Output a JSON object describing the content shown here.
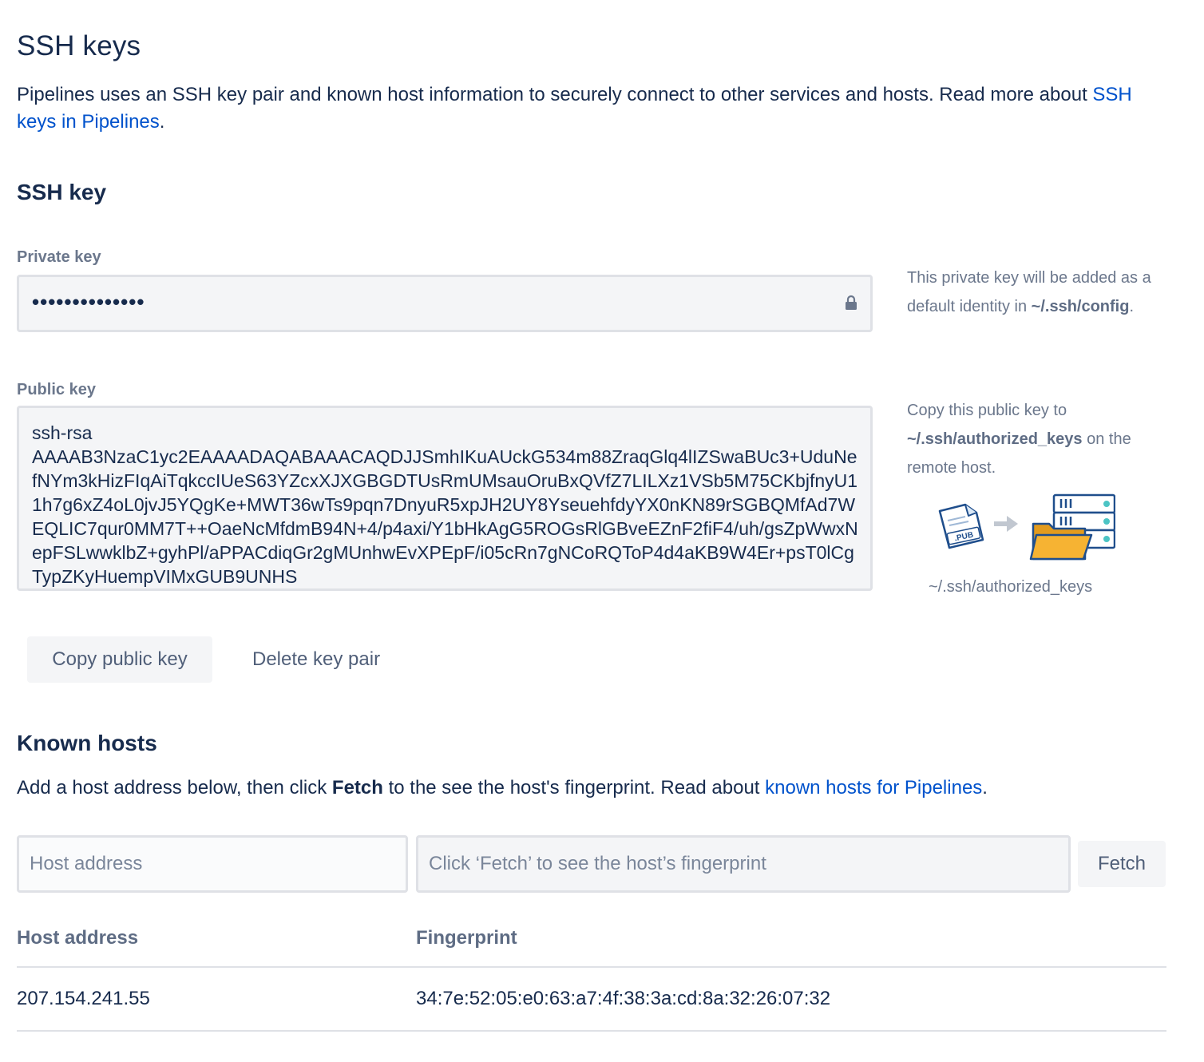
{
  "page": {
    "title": "SSH keys",
    "intro_text": "Pipelines uses an SSH key pair and known host information to securely connect to other services and hosts. Read more about ",
    "intro_link": "SSH keys in Pipelines",
    "intro_end": "."
  },
  "ssh_key": {
    "section_title": "SSH key",
    "private_label": "Private key",
    "private_value": "••••••••••••••",
    "private_help_1": "This private key will be added as a default identity in ",
    "private_help_path": "~/.ssh/config",
    "private_help_2": ".",
    "public_label": "Public key",
    "public_value": "ssh-rsa\nAAAAB3NzaC1yc2EAAAADAQABAAACAQDJJSmhIKuAUckG534m88ZraqGlq4lIZSwaBUc3+UduNefNYm3kHizFIqAiTqkccIUeS63YZcxXJXGBGDTUsRmUMsauOruBxQVfZ7LILXz1VSb5M75CKbjfnyU11h7g6xZ4oL0jvJ5YQgKe+MWT36wTs9pqn7DnyuR5xpJH2UY8YseuehfdyYX0nKN89rSGBQMfAd7WEQLIC7qur0MM7T++OaeNcMfdmB94N+4/p4axi/Y1bHkAgG5ROGsRlGBveEZnF2fiF4/uh/gsZpWwxNepFSLwwklbZ+gyhPl/aPPACdiqGr2gMUnhwEvXPEpF/i05cRn7gNCoRQToP4d4aKB9W4Er+psT0lCgTypZKyHuempVIMxGUB9UNHS",
    "public_help_1": "Copy this public key to ",
    "public_help_path": "~/.ssh/authorized_keys",
    "public_help_2": " on the remote host.",
    "illustration_file_label": ".PUB",
    "illustration_caption": "~/.ssh/authorized_keys",
    "copy_button": "Copy public key",
    "delete_button": "Delete key pair"
  },
  "known_hosts": {
    "section_title": "Known hosts",
    "desc_1": "Add a host address below, then click ",
    "desc_bold": "Fetch",
    "desc_2": " to the see the host's fingerprint. Read about ",
    "desc_link": "known hosts for Pipelines",
    "desc_end": ".",
    "host_placeholder": "Host address",
    "fingerprint_placeholder": "Click ‘Fetch’ to see the host’s fingerprint",
    "fetch_button": "Fetch",
    "columns": [
      "Host address",
      "Fingerprint"
    ],
    "rows": [
      {
        "host": "207.154.241.55",
        "fingerprint": "34:7e:52:05:e0:63:a7:4f:38:3a:cd:8a:32:26:07:32"
      }
    ]
  },
  "colors": {
    "text": "#172b4d",
    "subtle": "#6b778c",
    "link": "#0052cc",
    "field_bg": "#f4f5f7",
    "border": "#dfe1e6",
    "folder": "#f6b333",
    "server": "#4a9fd5"
  }
}
